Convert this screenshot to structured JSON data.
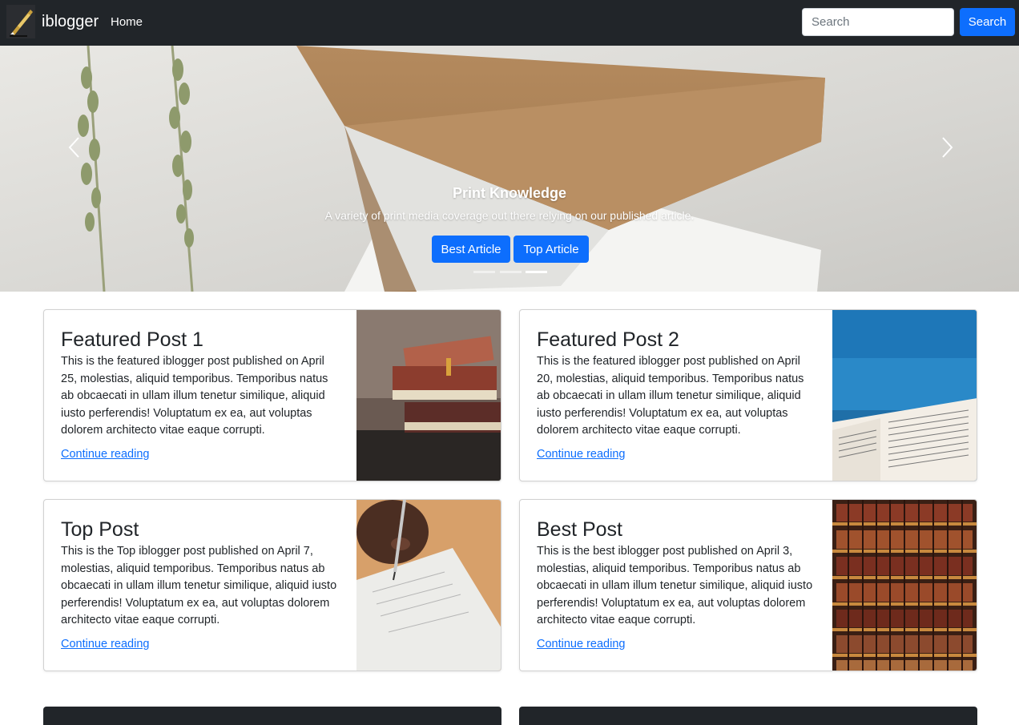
{
  "navbar": {
    "brand": "iblogger",
    "home_label": "Home",
    "search_placeholder": "Search",
    "search_button": "Search"
  },
  "hero": {
    "title": "Print Knowledge",
    "subtitle": "A variety of print media coverage out there relying on our published article.",
    "buttons": [
      "Best Article",
      "Top Article"
    ],
    "slide_count": 3,
    "active_slide": 3
  },
  "posts": [
    {
      "title": "Featured Post 1",
      "text": "This is the featured iblogger post published on April 25, molestias, aliquid temporibus. Temporibus natus ab obcaecati in ullam illum tenetur similique, aliquid iusto perferendis! Voluptatum ex ea, aut voluptas dolorem architecto vitae eaque corrupti.",
      "link": "Continue reading",
      "image": "books-stack"
    },
    {
      "title": "Featured Post 2",
      "text": "This is the featured iblogger post published on April 20, molestias, aliquid temporibus. Temporibus natus ab obcaecati in ullam illum tenetur similique, aliquid iusto perferendis! Voluptatum ex ea, aut voluptas dolorem architecto vitae eaque corrupti.",
      "link": "Continue reading",
      "image": "open-book-sea"
    },
    {
      "title": "Top Post",
      "text": "This is the Top iblogger post published on April 7, molestias, aliquid temporibus. Temporibus natus ab obcaecati in ullam illum tenetur similique, aliquid iusto perferendis! Voluptatum ex ea, aut voluptas dolorem architecto vitae eaque corrupti.",
      "link": "Continue reading",
      "image": "hand-writing"
    },
    {
      "title": "Best Post",
      "text": "This is the best iblogger post published on April 3, molestias, aliquid temporibus. Temporibus natus ab obcaecati in ullam illum tenetur similique, aliquid iusto perferendis! Voluptatum ex ea, aut voluptas dolorem architecto vitae eaque corrupti.",
      "link": "Continue reading",
      "image": "bookshelf"
    }
  ],
  "colors": {
    "navbar_bg": "#212529",
    "primary": "#0d6efd",
    "link": "#0d6efd"
  }
}
